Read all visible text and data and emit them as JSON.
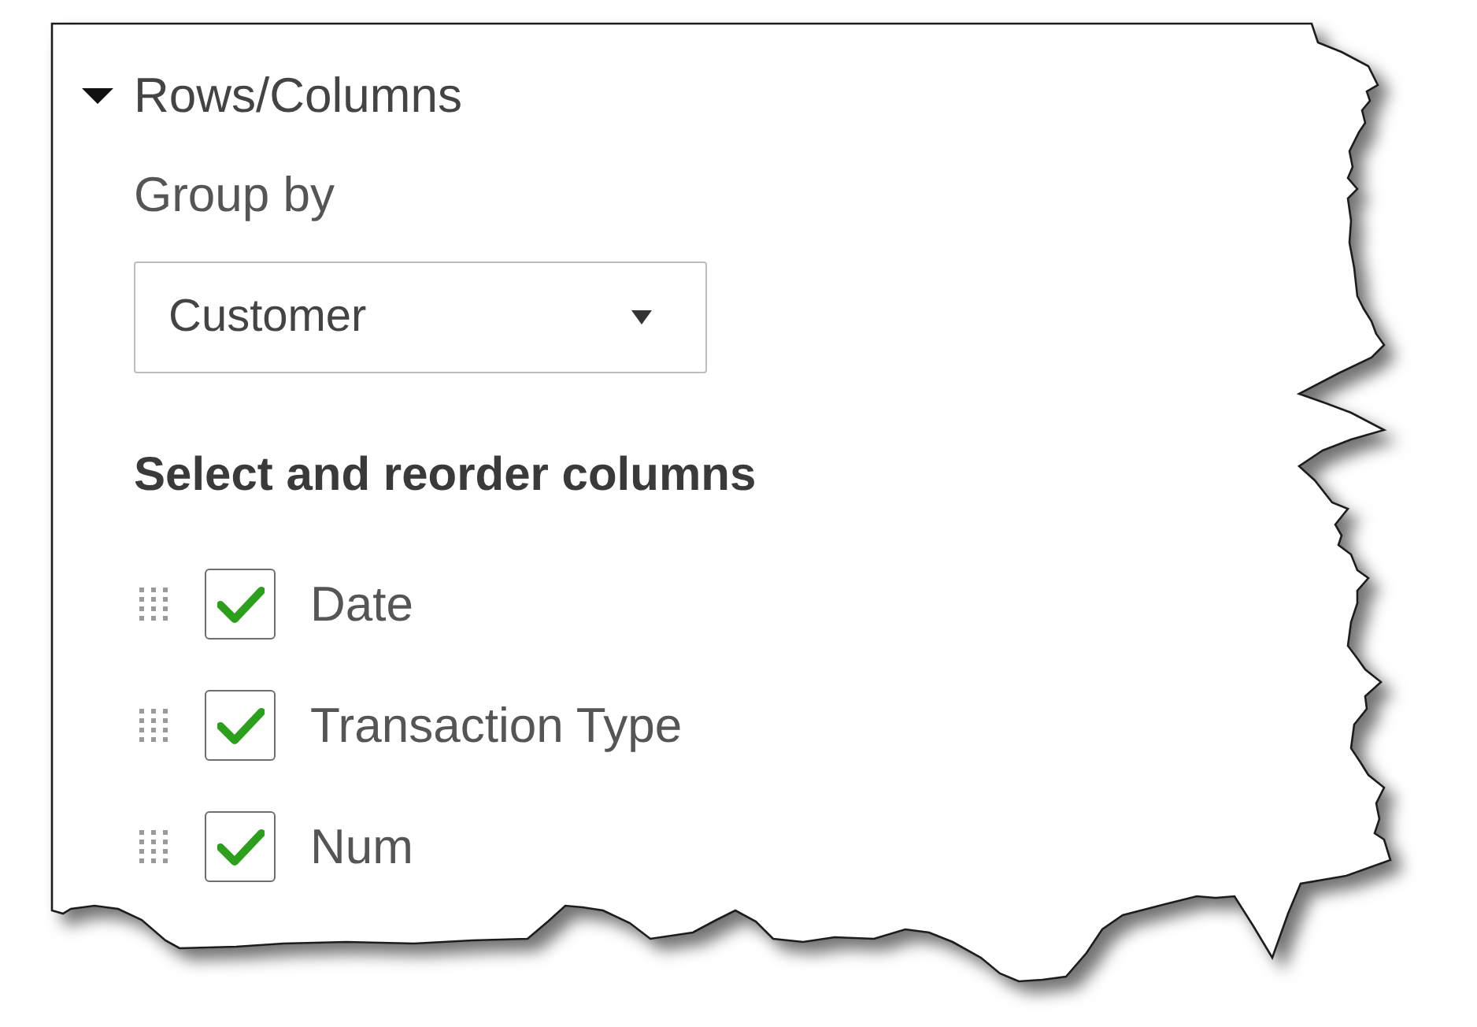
{
  "section": {
    "title": "Rows/Columns",
    "expanded": true
  },
  "group_by": {
    "label": "Group by",
    "value": "Customer"
  },
  "columns_heading": "Select and reorder columns",
  "columns": [
    {
      "label": "Date",
      "checked": true
    },
    {
      "label": "Transaction Type",
      "checked": true
    },
    {
      "label": "Num",
      "checked": true
    }
  ]
}
